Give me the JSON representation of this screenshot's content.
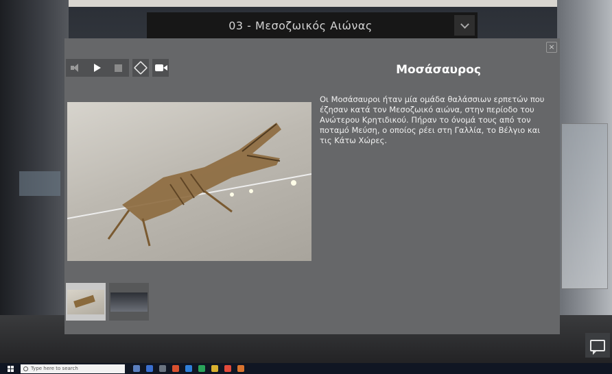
{
  "section_selector": {
    "title": "03 - Μεσοζωικός Αιώνας"
  },
  "modal": {
    "close_label": "×",
    "title": "Μοσάσαυρος",
    "description": "Οι Μοσάσαυροι ήταν μία ομάδα θαλάσσιων ερπετών που έζησαν κατά τον Μεσοζωικό αιώνα, στην περίοδο του Ανώτερου Κρητιδικού. Πήραν το όνομά τους από τον ποταμό Μεύση, ο οποίος ρέει στη Γαλλία, το Βέλγιο και τις Κάτω Χώρες.",
    "toolbar": {
      "icons": [
        "sound-icon",
        "play-icon",
        "stop-icon",
        "3d-cube-icon",
        "video-camera-icon"
      ]
    }
  },
  "taskbar": {
    "search_placeholder": "Type here to search"
  },
  "colors": {
    "modal_bg": "#666769",
    "section_bar_bg": "#171717",
    "taskbar_bg": "#101623"
  }
}
